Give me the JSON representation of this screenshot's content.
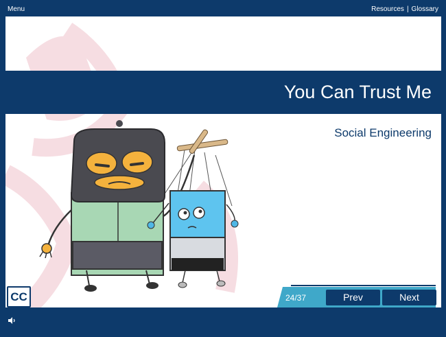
{
  "topbar": {
    "menu_label": "Menu",
    "resources_label": "Resources",
    "separator": "|",
    "glossary_label": "Glossary"
  },
  "slide": {
    "title": "You Can Trust Me",
    "subtitle": "Social Engineering"
  },
  "controls": {
    "cc_label": "CC",
    "counter": "24/37",
    "prev_label": "Prev",
    "next_label": "Next",
    "volume_icon": "speaker-icon"
  },
  "colors": {
    "navy": "#0d3a6b",
    "teal": "#3fa8c9",
    "watermark": "#f6dde2"
  }
}
